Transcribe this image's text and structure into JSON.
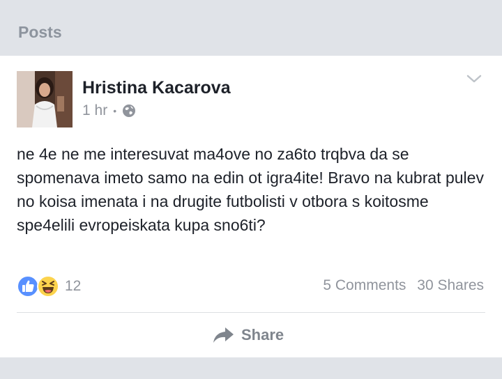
{
  "section": {
    "title": "Posts"
  },
  "post": {
    "author": "Hristina Kacarova",
    "timestamp": "1 hr",
    "separator": "•",
    "privacy_icon": "globe-icon",
    "text": "ne 4e ne me interesuvat ma4ove no za6to trqbva da se spomenava imeto samo na edin ot igra4ite! Bravo na kubrat pulev no koisa imenata i na drugite futbolisti v otbora s koitosme spe4elili evropeiskata kupa sno6ti?",
    "reactions": {
      "icons": [
        "like-icon",
        "haha-icon"
      ],
      "count": "12"
    },
    "comments": "5 Comments",
    "shares": "30 Shares",
    "share_label": "Share"
  },
  "colors": {
    "background": "#e0e3e8",
    "card": "#ffffff",
    "like_blue": "#5890ff",
    "haha_yellow": "#fcd34d",
    "text": "#1d2129",
    "secondary_text": "#90949c"
  }
}
